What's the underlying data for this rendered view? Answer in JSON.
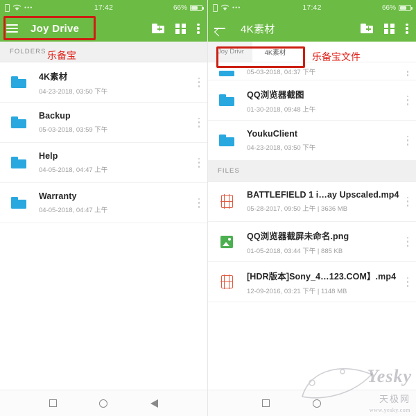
{
  "status_bar": {
    "time": "17:42",
    "battery_percent": "66%",
    "battery_level": 66,
    "icons": [
      "sim-card-icon",
      "wifi-icon",
      "more-dots-icon",
      "battery-icon"
    ]
  },
  "colors": {
    "app_bar_green": "#6cbb45",
    "folder_blue": "#29a8e0",
    "video_red": "#e0593f",
    "image_green": "#4caf50",
    "annotation_red": "#cc1f12"
  },
  "left_panel": {
    "app_bar": {
      "menu_icon": "hamburger-icon",
      "title": "Joy Drive",
      "actions": [
        {
          "name": "new-folder-icon",
          "label": "新建文件夹"
        },
        {
          "name": "grid-view-icon",
          "label": "网格视图"
        },
        {
          "name": "overflow-menu-icon",
          "label": "更多"
        }
      ]
    },
    "section_label": "FOLDERS",
    "folders": [
      {
        "name": "4K素材",
        "meta": "04-23-2018, 03:50 下午",
        "icon": "folder-icon"
      },
      {
        "name": "Backup",
        "meta": "05-03-2018, 03:59 下午",
        "icon": "folder-icon"
      },
      {
        "name": "Help",
        "meta": "04-05-2018, 04:47 上午",
        "icon": "folder-icon"
      },
      {
        "name": "Warranty",
        "meta": "04-05-2018, 04:47 上午",
        "icon": "folder-icon"
      }
    ],
    "annotation": "乐备宝"
  },
  "right_panel": {
    "app_bar": {
      "back_icon": "back-arrow-icon",
      "title": "4K素材",
      "actions": [
        {
          "name": "new-folder-icon",
          "label": "新建文件夹"
        },
        {
          "name": "grid-view-icon",
          "label": "网格视图"
        },
        {
          "name": "overflow-menu-icon",
          "label": "更多"
        }
      ]
    },
    "breadcrumb": [
      {
        "label": "Joy Drive"
      },
      {
        "label": "4K素材"
      }
    ],
    "annotation": "乐备宝文件",
    "partial_row_meta": "05-03-2018, 04:37 下午",
    "folders": [
      {
        "name": "QQ浏览器截图",
        "meta": "01-30-2018, 09:48 上午",
        "icon": "folder-icon"
      },
      {
        "name": "YoukuClient",
        "meta": "04-23-2018, 03:50 下午",
        "icon": "folder-icon"
      }
    ],
    "files_section_label": "FILES",
    "files": [
      {
        "name": "BATTLEFIELD 1 i…ay Upscaled.mp4",
        "meta": "05-28-2017, 09:50 上午 | 3636 MB",
        "icon": "video-file-icon"
      },
      {
        "name": "QQ浏览器截屏未命名.png",
        "meta": "01-05-2018, 03:44 下午 | 885 KB",
        "icon": "image-file-icon"
      },
      {
        "name": "[HDR版本]Sony_4…123.COM】.mp4",
        "meta": "12-09-2016, 03:21 下午 | 1148 MB",
        "icon": "video-file-icon"
      }
    ]
  },
  "nav_bar": {
    "buttons": [
      {
        "name": "recents-button",
        "shape": "square"
      },
      {
        "name": "home-button",
        "shape": "circle"
      },
      {
        "name": "back-button",
        "shape": "triangle"
      }
    ]
  },
  "watermark": {
    "brand": "Yesky",
    "cn": "天极网",
    "url": "www.yesky.com"
  }
}
